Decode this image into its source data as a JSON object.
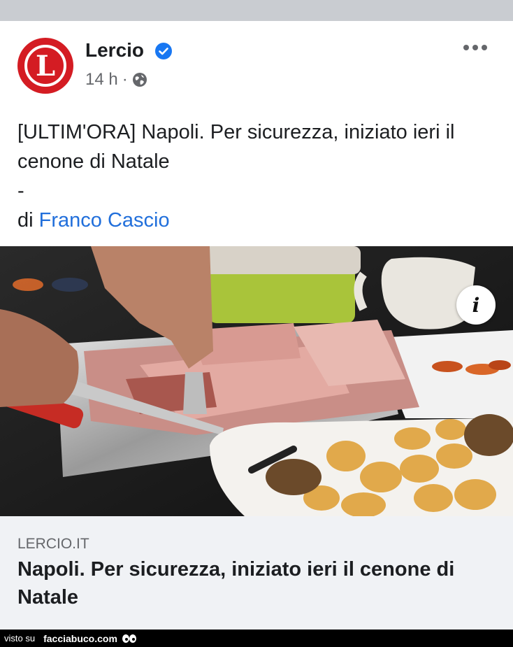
{
  "post": {
    "page_name": "Lercio",
    "avatar_letter": "L",
    "time": "14 h",
    "separator": "·",
    "text_line": "[ULTIM'ORA] Napoli. Per sicurezza, iniziato ieri il cenone di Natale",
    "dash": "-",
    "by_prefix": "di",
    "author": "Franco Cascio",
    "info_label": "i"
  },
  "link": {
    "domain": "LERCIO.IT",
    "title": "Napoli. Per sicurezza, iniziato ieri il cenone di Natale"
  },
  "footer": {
    "visto": "visto su",
    "site": "facciabuco.com"
  },
  "colors": {
    "brand_red": "#d41c23",
    "verified_blue": "#1877f2",
    "link_blue": "#216fdb"
  },
  "icons": {
    "verified": "verified-badge-icon",
    "globe": "globe-icon",
    "more": "more-options-icon",
    "info": "info-icon"
  }
}
